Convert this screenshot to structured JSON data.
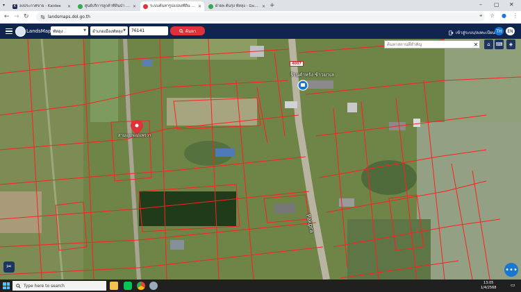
{
  "browser": {
    "tabs": [
      {
        "title": "ลงประกาศขาย - Kaidee",
        "favicon_color": "#1f2b52",
        "favicon_glyph": "K",
        "active": false
      },
      {
        "title": "ศูนย์บริการลูกค้าที่ดินป่า พัทลุง - Goo",
        "favicon_color": "#34a853",
        "favicon_glyph": "",
        "active": false
      },
      {
        "title": "ระบบค้นหารูปแปลงที่ดิน (LandsMa",
        "favicon_color": "#e0303a",
        "favicon_glyph": "",
        "active": true
      },
      {
        "title": "ฝ่ายพ ต้นรุ่ง พัทลุง - Google Maps",
        "favicon_color": "#34a853",
        "favicon_glyph": "",
        "active": false
      }
    ],
    "url": "landsmaps.dol.go.th"
  },
  "header": {
    "brand": "LandsMaps",
    "province": "พัทลุง",
    "district": "อำเภอเมืองพัทลุง",
    "parcel_value": "76141",
    "search_label": "ค้นหา",
    "login_label": "เข้าสู่ระบบ/ลงทะเบียน",
    "lang_th": "TH",
    "lang_en": "EN"
  },
  "map": {
    "place_search_placeholder": "ค้นหาสถานที่สำคัญ",
    "road_number": "4007",
    "label_shop": "ร้านคำหรัง ข้าวมาเล",
    "label_parcel": "สามแยกแม่แพรวา",
    "label_road": "Pakpra",
    "colors": {
      "parcel_line": "#ff2020",
      "pin": "#e0303a",
      "pin_blue": "#1976d2"
    }
  },
  "taskbar": {
    "search_placeholder": "Type here to search",
    "time": "13:05",
    "date": "1/4/2568"
  }
}
